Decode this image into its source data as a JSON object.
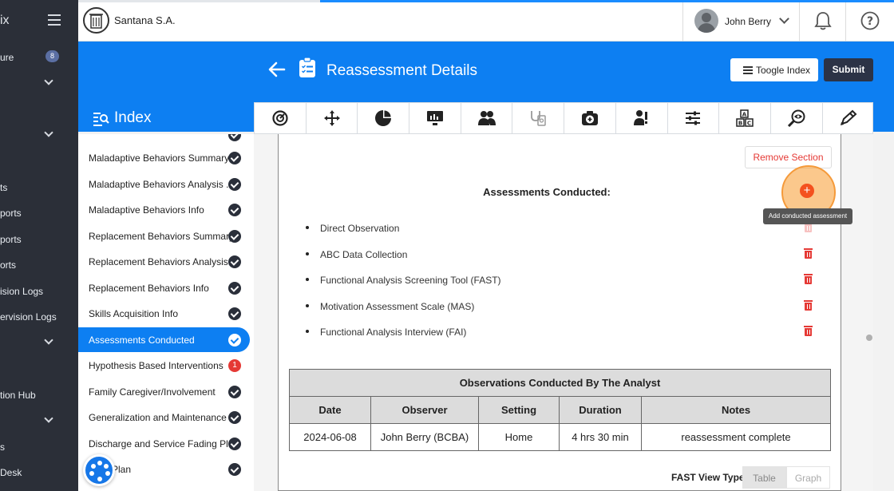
{
  "left_nav": {
    "brand": "ix",
    "items": [
      {
        "label": "ure",
        "badge": "8"
      },
      {
        "label": "ts"
      },
      {
        "label": "ports"
      },
      {
        "label": "ports"
      },
      {
        "label": "orts"
      },
      {
        "label": "ision Logs"
      },
      {
        "label": "ervision Logs"
      },
      {
        "label": "tion Hub"
      },
      {
        "label": "s"
      },
      {
        "label": "Desk"
      }
    ]
  },
  "header": {
    "company": "Santana S.A.",
    "user_name": "John Berry",
    "icons": [
      "bell-icon",
      "help-icon"
    ]
  },
  "page": {
    "title": "Reassessment Details",
    "toggle_index_label": "Toogle Index",
    "submit_label": "Submit"
  },
  "index": {
    "title": "Index",
    "items": [
      {
        "label": "Maladaptive Behaviors Summary",
        "status": "done"
      },
      {
        "label": "Maladaptive Behaviors Analysis ...",
        "status": "done"
      },
      {
        "label": "Maladaptive Behaviors Info",
        "status": "done"
      },
      {
        "label": "Replacement Behaviors Summary",
        "status": "done"
      },
      {
        "label": "Replacement Behaviors Analysis...",
        "status": "done"
      },
      {
        "label": "Replacement Behaviors Info",
        "status": "done"
      },
      {
        "label": "Skills Acquisition Info",
        "status": "done"
      },
      {
        "label": "Assessments Conducted",
        "status": "active"
      },
      {
        "label": "Hypothesis Based Interventions",
        "status": "badge",
        "badge": "1"
      },
      {
        "label": "Family Caregiver/Involvement",
        "status": "done"
      },
      {
        "label": "Generalization and Maintenance",
        "status": "done"
      },
      {
        "label": "Discharge and Service Fading Pl...",
        "status": "done"
      },
      {
        "label": "Plan",
        "status": "done"
      }
    ]
  },
  "tabs": [
    "gauge-icon",
    "move-icon",
    "pie-icon",
    "monitor-chart-icon",
    "group-icon",
    "stethoscope-icon",
    "camera-plus-icon",
    "user-alert-icon",
    "sliders-icon",
    "abc-blocks-icon",
    "search-eye-icon",
    "pen-icon"
  ],
  "section": {
    "remove_label": "Remove Section",
    "title": "Assessments Conducted:",
    "add_tooltip": "Add conducted assessment",
    "assessments": [
      "Direct Observation",
      "ABC Data Collection",
      "Functional Analysis Screening Tool (FAST)",
      "Motivation Assessment Scale (MAS)",
      "Functional Analysis Interview (FAI)"
    ]
  },
  "observations_table": {
    "title": "Observations Conducted By The Analyst",
    "columns": [
      "Date",
      "Observer",
      "Setting",
      "Duration",
      "Notes"
    ],
    "rows": [
      [
        "2024-06-08",
        "John Berry (BCBA)",
        "Home",
        "4 hrs 30 min",
        "reassessment complete"
      ]
    ]
  },
  "fast_view": {
    "label": "FAST View Type:",
    "options": [
      "Table",
      "Graph"
    ],
    "selected": "Table"
  },
  "colors": {
    "primary_blue": "#0d7ff2",
    "sidebar_dark": "#2b2f38",
    "danger_red": "#e53935",
    "submit_dark": "#2c3346",
    "highlight_orange": "#f59a3a"
  }
}
